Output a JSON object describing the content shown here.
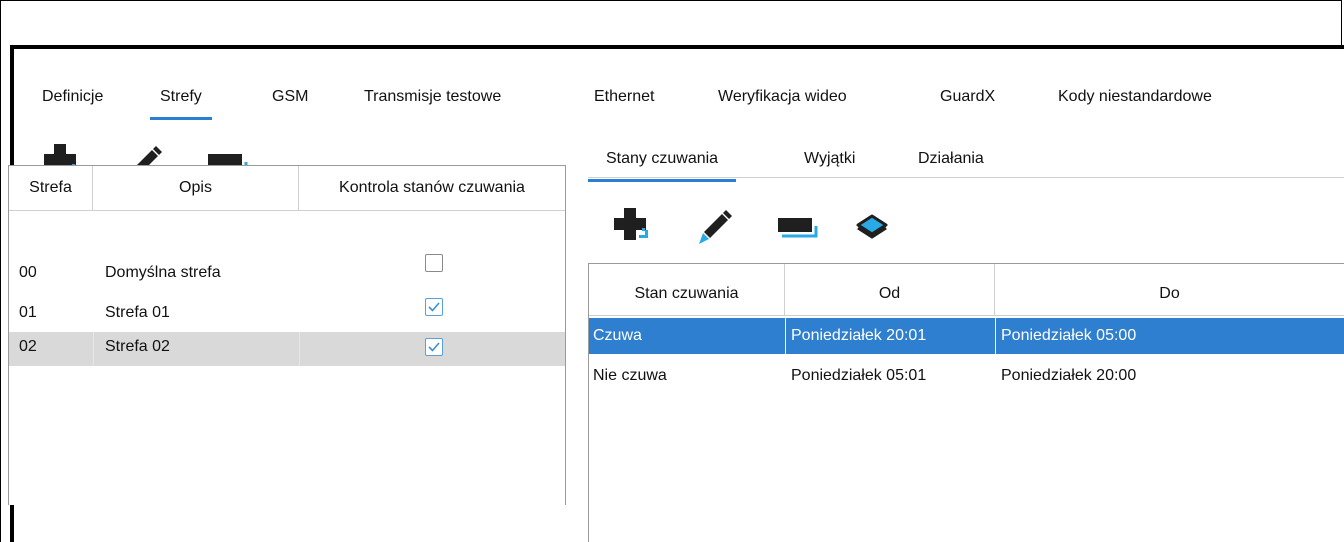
{
  "top_tabs": [
    {
      "label": "Definicje",
      "active": false
    },
    {
      "label": "Strefy",
      "active": true
    },
    {
      "label": "GSM",
      "active": false
    },
    {
      "label": "Transmisje testowe",
      "active": false
    },
    {
      "label": "Ethernet",
      "active": false
    },
    {
      "label": "Weryfikacja wideo",
      "active": false
    },
    {
      "label": "GuardX",
      "active": false
    },
    {
      "label": "Kody niestandardowe",
      "active": false
    }
  ],
  "left_toolbar": {
    "icons": [
      "add-icon",
      "edit-icon",
      "delete-icon"
    ]
  },
  "left_table": {
    "columns": [
      "Strefa",
      "Opis",
      "Kontrola stanów czuwania"
    ],
    "rows": [
      {
        "strefa": "00",
        "opis": "Domyślna strefa",
        "kontrola": false,
        "selected": false
      },
      {
        "strefa": "01",
        "opis": "Strefa 01",
        "kontrola": true,
        "selected": false
      },
      {
        "strefa": "02",
        "opis": "Strefa 02",
        "kontrola": true,
        "selected": true
      }
    ]
  },
  "sub_tabs": [
    {
      "label": "Stany czuwania",
      "active": true
    },
    {
      "label": "Wyjątki",
      "active": false
    },
    {
      "label": "Działania",
      "active": false
    }
  ],
  "right_toolbar": {
    "icons": [
      "add-icon",
      "edit-icon",
      "delete-icon",
      "layers-icon"
    ]
  },
  "right_table": {
    "columns": [
      "Stan czuwania",
      "Od",
      "Do"
    ],
    "rows": [
      {
        "stan": "Czuwa",
        "od": "Poniedziałek 20:01",
        "do": "Poniedziałek 05:00",
        "selected": true
      },
      {
        "stan": "Nie czuwa",
        "od": "Poniedziałek 05:01",
        "do": "Poniedziałek 20:00",
        "selected": false
      }
    ]
  },
  "colors": {
    "accent": "#2a7fd4",
    "selection_blue": "#2f7fd0",
    "selection_gray": "#d9d9d9",
    "icon_dark": "#1f1f1f",
    "icon_blue": "#29a9e6"
  }
}
